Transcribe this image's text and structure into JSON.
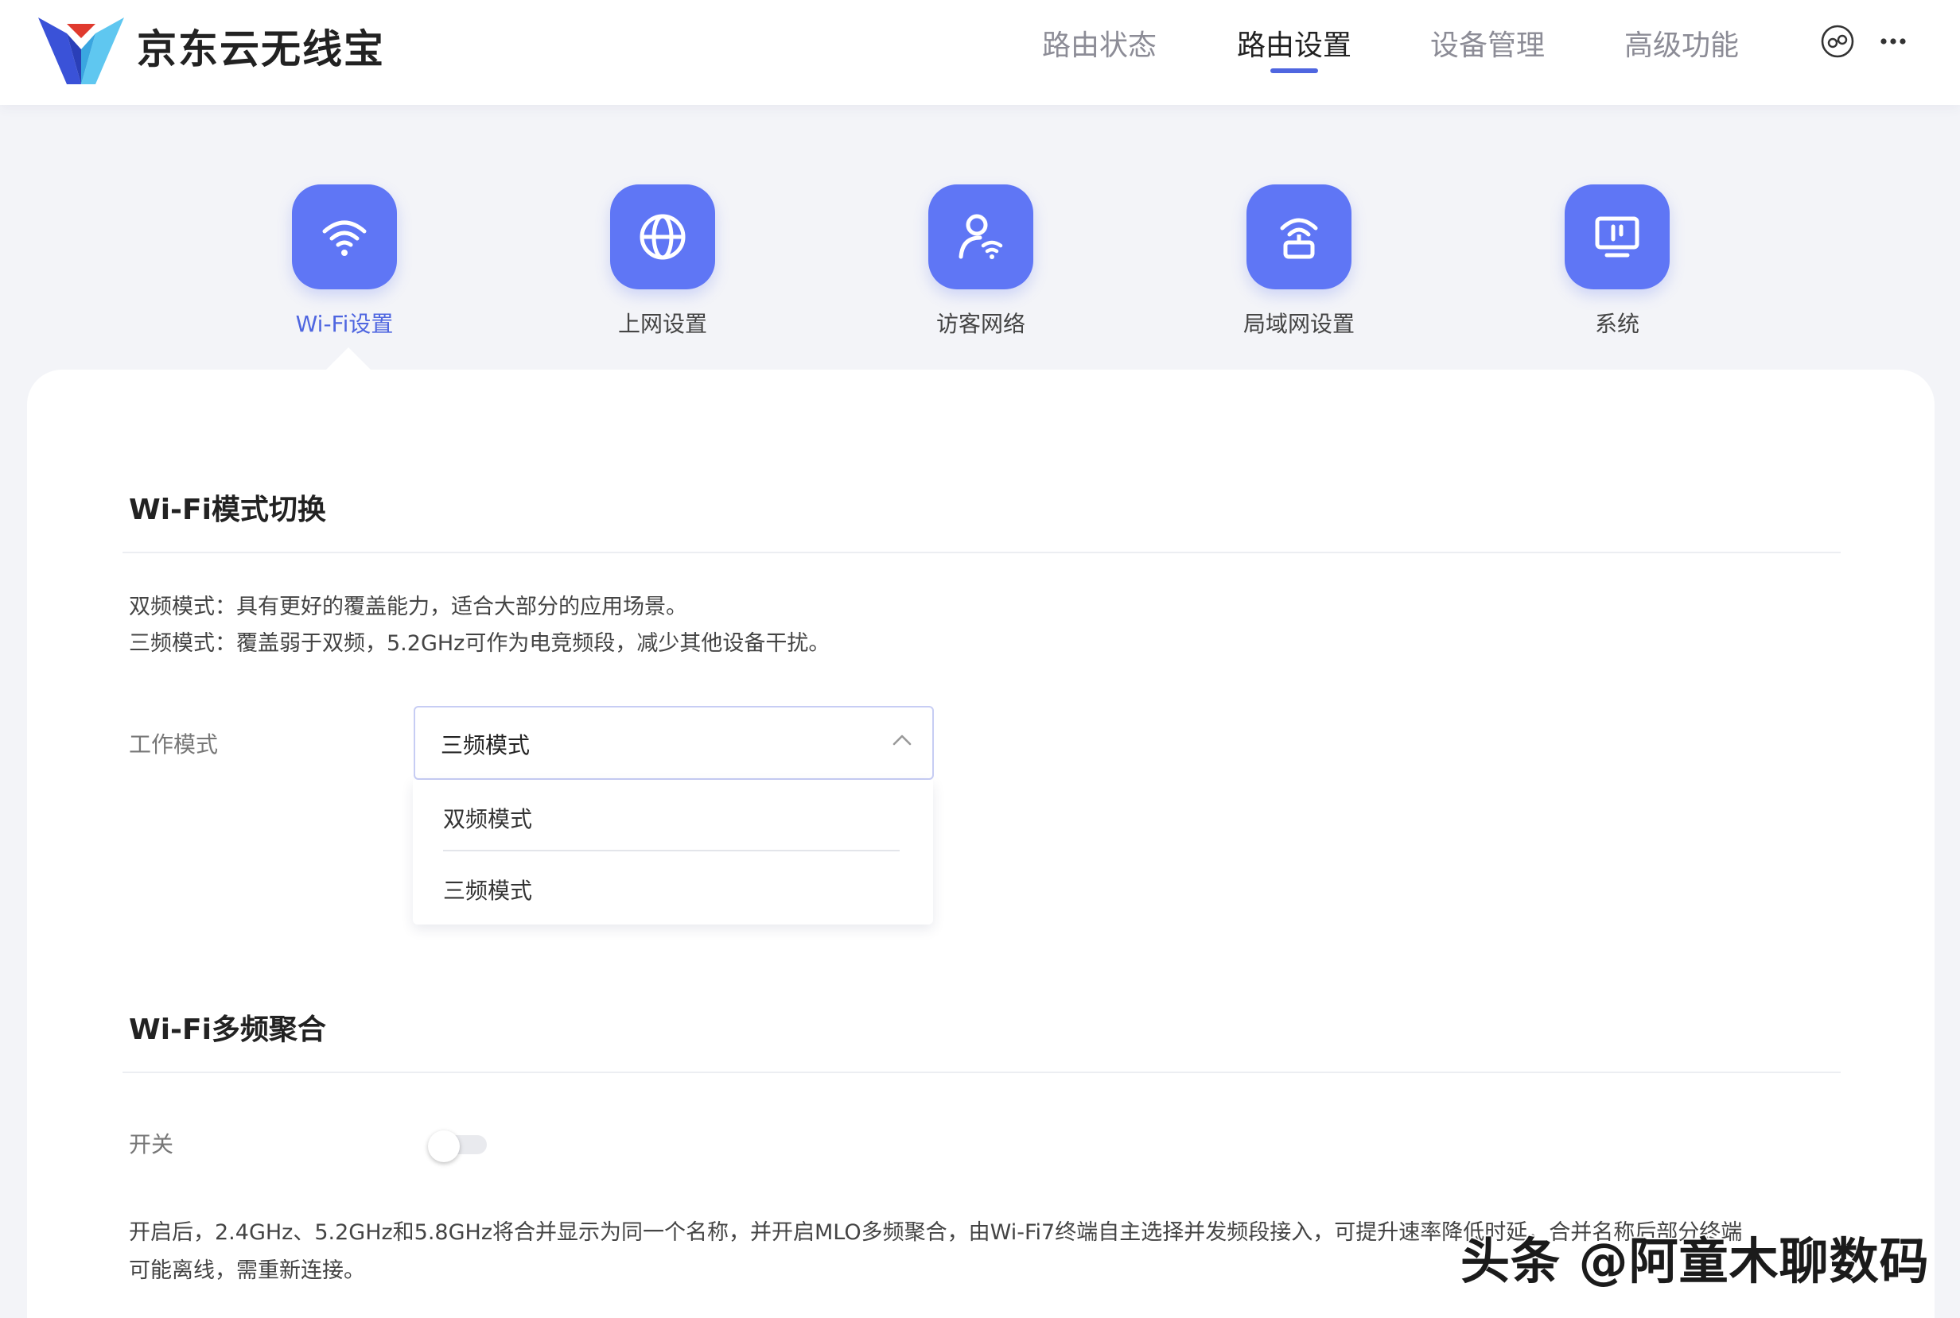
{
  "header": {
    "brand": "京东云无线宝",
    "nav": [
      {
        "label": "路由状态"
      },
      {
        "label": "路由设置"
      },
      {
        "label": "设备管理"
      },
      {
        "label": "高级功能"
      }
    ],
    "active_nav": "路由设置",
    "icons": [
      "link-icon",
      "more-icon"
    ]
  },
  "categories": [
    {
      "label": "Wi-Fi设置",
      "icon": "wifi-icon"
    },
    {
      "label": "上网设置",
      "icon": "globe-icon"
    },
    {
      "label": "访客网络",
      "icon": "guest-user-icon"
    },
    {
      "label": "局域网设置",
      "icon": "router-icon"
    },
    {
      "label": "系统",
      "icon": "monitor-icon"
    }
  ],
  "active_category": "Wi-Fi设置",
  "wifi_mode": {
    "title": "Wi-Fi模式切换",
    "desc_line1": "双频模式：具有更好的覆盖能力，适合大部分的应用场景。",
    "desc_line2": "三频模式：覆盖弱于双频，5.2GHz可作为电竞频段，减少其他设备干扰。",
    "field_label": "工作模式",
    "selected": "三频模式",
    "options": [
      "双频模式",
      "三频模式"
    ]
  },
  "aggregation": {
    "title": "Wi-Fi多频聚合",
    "switch_label": "开关",
    "switch_on": false,
    "note_line1": "开启后，2.4GHz、5.2GHz和5.8GHz将合并显示为同一个名称，并开启MLO多频聚合，由Wi-Fi7终端自主选择并发频段接入，可提升速率降低时延，合并名称后部分终端",
    "note_line2": "可能离线，需重新连接。"
  },
  "watermark": "头条 @阿童木聊数码",
  "colors": {
    "accent": "#4f66e0",
    "tile": "#5f76f5",
    "background": "#f3f4f8"
  }
}
